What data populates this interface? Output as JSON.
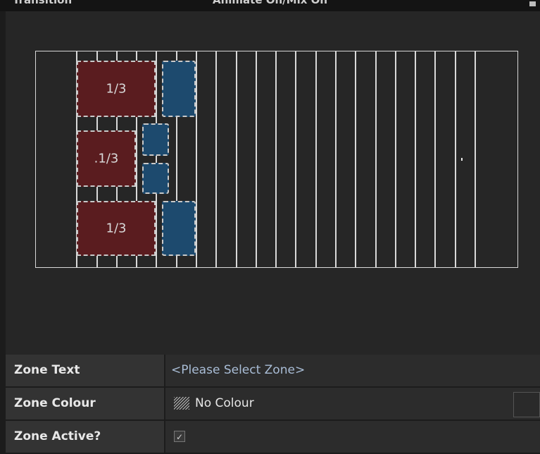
{
  "header": {
    "left_partial_title": "Transition",
    "center_partial_title": "Animate On/Mix On"
  },
  "zones": [
    {
      "label": "1/3",
      "color": "#5a1c1f"
    },
    {
      "label": ".1/3",
      "color": "#5a1c1f"
    },
    {
      "label": "1/3",
      "color": "#5a1c1f"
    },
    {
      "label": "",
      "color": "#1d4a6e"
    },
    {
      "label": "",
      "color": "#1d4a6e"
    },
    {
      "label": "",
      "color": "#1d4a6e"
    },
    {
      "label": "",
      "color": "#1d4a6e"
    }
  ],
  "properties": {
    "zone_text": {
      "label": "Zone Text",
      "value": "<Please Select Zone>"
    },
    "zone_colour": {
      "label": "Zone Colour",
      "value": "No Colour",
      "swatch_icon": "hatch-pattern-icon"
    },
    "zone_active": {
      "label": "Zone Active?",
      "checked": true,
      "check_glyph": "✓"
    }
  }
}
